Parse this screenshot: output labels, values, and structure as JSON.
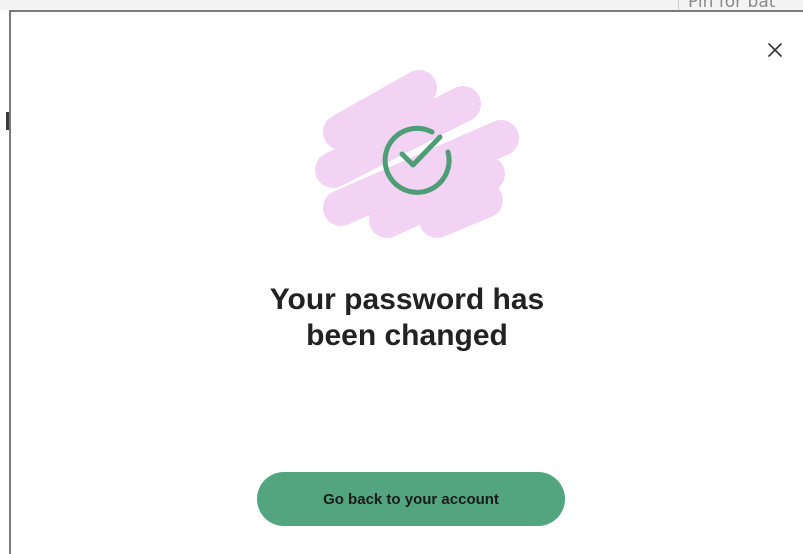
{
  "background_page": {
    "top_right_text": "Pin for bat"
  },
  "modal": {
    "close_icon": "close-icon",
    "illustration_icon": "check-circle-icon",
    "title_line_1": "Your password has",
    "title_line_2": "been changed",
    "primary_button_label": "Go back to your account"
  },
  "colors": {
    "accent": "#52a57f",
    "blob": "#f2d3f3",
    "title": "#222222"
  }
}
